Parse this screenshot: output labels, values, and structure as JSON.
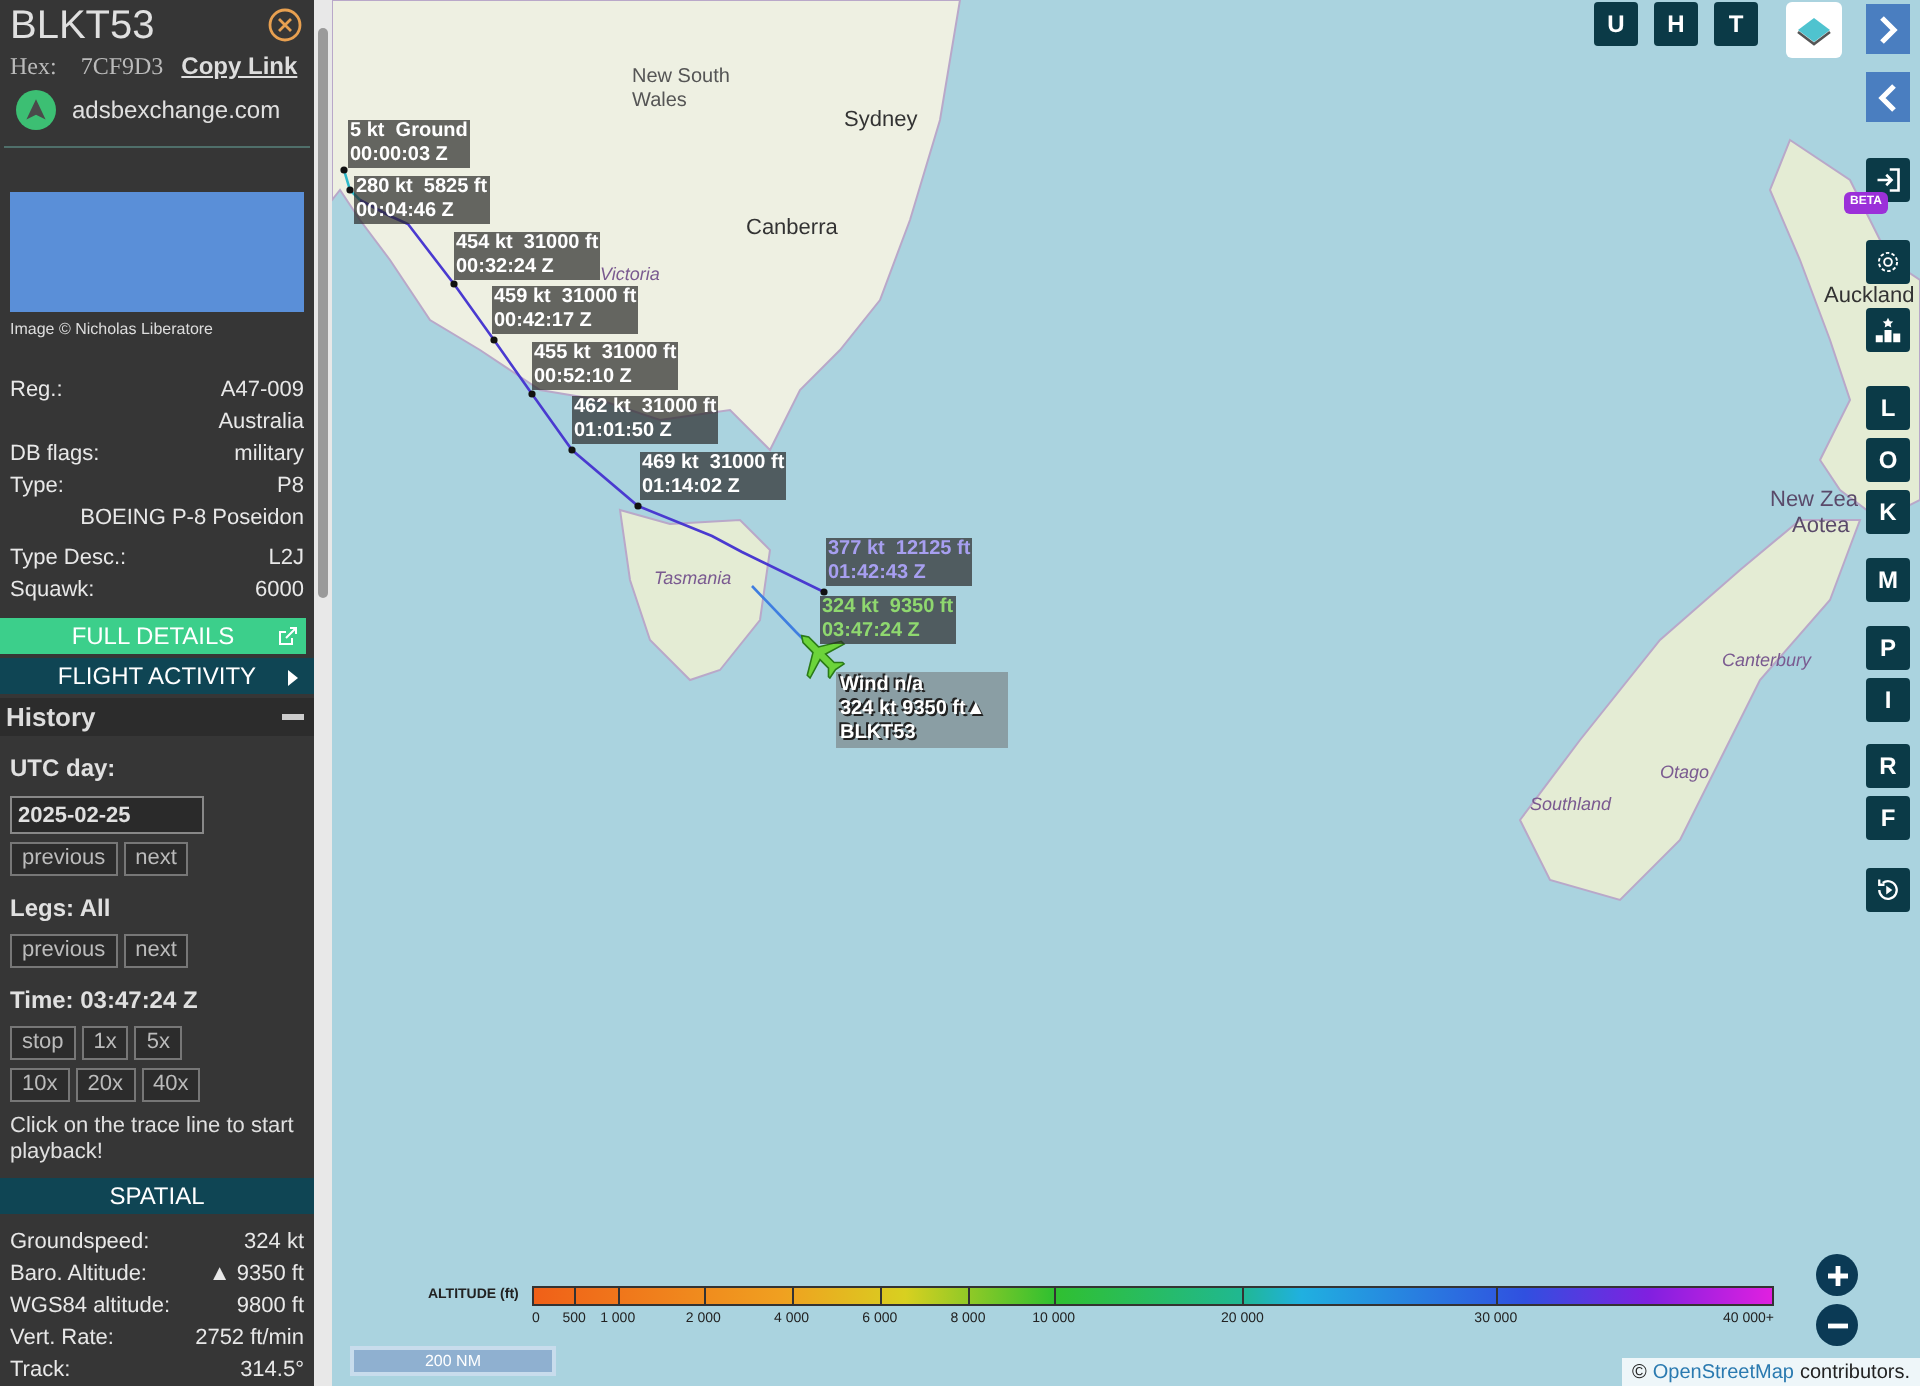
{
  "panel": {
    "callsign": "BLKT53",
    "hex_label": "Hex:",
    "hex": "7CF9D3",
    "copy_link": "Copy Link",
    "source": "adsbexchange.com",
    "photo_credit": "Image © Nicholas Liberatore",
    "details": [
      {
        "label": "Reg.:",
        "value": "A47-009"
      },
      {
        "value": "Australia"
      },
      {
        "label": "DB flags:",
        "value": "military"
      },
      {
        "label": "Type:",
        "value": "P8"
      },
      {
        "value": "BOEING P-8 Poseidon"
      },
      {
        "label": "Type Desc.:",
        "value": "L2J"
      },
      {
        "label": "Squawk:",
        "value": "6000"
      }
    ],
    "full_details": "FULL DETAILS",
    "flight_activity": "FLIGHT ACTIVITY",
    "history": {
      "title": "History",
      "utc_day_label": "UTC day:",
      "date": "2025-02-25",
      "day_buttons": [
        "previous",
        "next"
      ],
      "legs_label": "Legs: All",
      "leg_buttons": [
        "previous",
        "next"
      ],
      "time": "Time: 03:47:24 Z",
      "speed_buttons": [
        [
          "stop",
          "1x",
          "5x"
        ],
        [
          "10x",
          "20x",
          "40x"
        ]
      ],
      "hint": "Click on the trace line to start playback!"
    },
    "spatial": {
      "title": "SPATIAL",
      "rows": [
        {
          "label": "Groundspeed:",
          "value": "324 kt"
        },
        {
          "label": "Baro. Altitude:",
          "value": "▲ 9350 ft"
        },
        {
          "label": "WGS84 altitude:",
          "value": "9800 ft"
        },
        {
          "label": "Vert. Rate:",
          "value": "2752 ft/min"
        },
        {
          "label": "Track:",
          "value": "314.5°"
        }
      ]
    }
  },
  "map": {
    "places": [
      {
        "name": "New South Wales",
        "kind": "region"
      },
      {
        "name": "Sydney",
        "kind": "city"
      },
      {
        "name": "Canberra",
        "kind": "city"
      },
      {
        "name": "Victoria",
        "kind": "state"
      },
      {
        "name": "Tasmania",
        "kind": "state"
      },
      {
        "name": "Auckland",
        "kind": "city"
      },
      {
        "name": "New Zea",
        "kind": "country"
      },
      {
        "name": "Aotea",
        "kind": "country"
      },
      {
        "name": "Canterbury",
        "kind": "state"
      },
      {
        "name": "Otago",
        "kind": "state"
      },
      {
        "name": "Southland",
        "kind": "state"
      }
    ],
    "track_labels": [
      {
        "speed": "5 kt",
        "altitude": "Ground",
        "time": "00:00:03 Z",
        "kind": "waypoint"
      },
      {
        "speed": "280 kt",
        "altitude": "5825 ft",
        "time": "00:04:46 Z",
        "kind": "waypoint"
      },
      {
        "speed": "454 kt",
        "altitude": "31000 ft",
        "time": "00:32:24 Z",
        "kind": "waypoint"
      },
      {
        "speed": "459 kt",
        "altitude": "31000 ft",
        "time": "00:42:17 Z",
        "kind": "waypoint"
      },
      {
        "speed": "455 kt",
        "altitude": "31000 ft",
        "time": "00:52:10 Z",
        "kind": "waypoint"
      },
      {
        "speed": "462 kt",
        "altitude": "31000 ft",
        "time": "01:01:50 Z",
        "kind": "waypoint"
      },
      {
        "speed": "469 kt",
        "altitude": "31000 ft",
        "time": "01:14:02 Z",
        "kind": "waypoint"
      },
      {
        "speed": "377 kt",
        "altitude": "12125 ft",
        "time": "01:42:43 Z",
        "kind": "leg_end"
      },
      {
        "speed": "324 kt",
        "altitude": "9350 ft",
        "time": "03:47:24 Z",
        "kind": "current"
      }
    ],
    "aircraft_box": [
      "Wind n/a",
      "324 kt  9350 ft▲",
      "BLKT53"
    ],
    "top_buttons": [
      "U",
      "H",
      "T"
    ],
    "side_buttons": [
      {
        "kind": "login",
        "badge": "BETA"
      },
      {
        "kind": "settings"
      },
      {
        "kind": "podium"
      },
      {
        "kind": "letter",
        "label": "L"
      },
      {
        "kind": "letter",
        "label": "O"
      },
      {
        "kind": "letter",
        "label": "K"
      },
      {
        "kind": "letter",
        "label": "M"
      },
      {
        "kind": "letter",
        "label": "P"
      },
      {
        "kind": "letter",
        "label": "I"
      },
      {
        "kind": "letter",
        "label": "R"
      },
      {
        "kind": "letter",
        "label": "F"
      },
      {
        "kind": "replay"
      }
    ],
    "legend": {
      "title": "ALTITUDE (ft)",
      "ticks": [
        "0",
        "500",
        "1 000",
        "2 000",
        "4 000",
        "6 000",
        "8 000",
        "10 000",
        "20 000",
        "30 000",
        "40 000+"
      ]
    },
    "scale": "200 NM",
    "attribution": {
      "prefix": "©",
      "link": "OpenStreetMap",
      "suffix": "contributors."
    }
  }
}
